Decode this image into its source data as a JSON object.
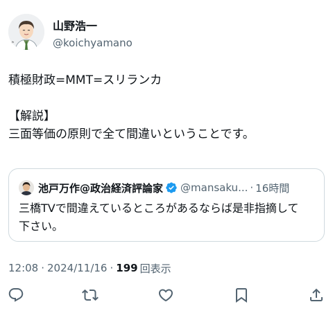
{
  "post": {
    "author": {
      "display_name": "山野浩一",
      "handle": "@koichyamano",
      "avatar": "illustrated-avatar"
    },
    "body": {
      "line1": "積極財政=MMT=スリランカ",
      "line2": "【解説】",
      "line3": "三面等価の原則で全て間違いということです。"
    },
    "quoted_post": {
      "display_name": "池戸万作@政治経済評論家",
      "verified": true,
      "handle": "@mansaku...",
      "separator": "·",
      "time": "16時間",
      "text_line1": "三橋TVで間違えているところがあるならば是非指摘して",
      "text_line2": "下さい。"
    },
    "meta": {
      "time": "12:08",
      "separator": "·",
      "date": "2024/11/16",
      "separator2": "·",
      "views_count": "199",
      "views_label": "回表示"
    },
    "actions": [
      {
        "name": "reply",
        "icon": "reply-icon"
      },
      {
        "name": "repost",
        "icon": "repost-icon"
      },
      {
        "name": "like",
        "icon": "heart-icon"
      },
      {
        "name": "bookmark",
        "icon": "bookmark-icon"
      },
      {
        "name": "share",
        "icon": "share-icon"
      }
    ],
    "colors": {
      "text": "#0f1419",
      "secondary": "#536471",
      "border": "#cfd9de",
      "verified": "#1d9bf0"
    }
  }
}
